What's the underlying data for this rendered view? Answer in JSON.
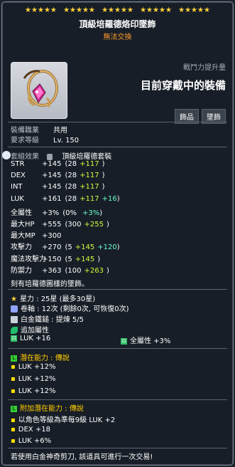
{
  "stars": [
    "★★★★★",
    "★★★★★",
    "★★★★★",
    "★★★★★",
    "★★★★★"
  ],
  "title": "頂級培羅德烙印墜飾",
  "subtitle": "無法交換",
  "combat_power": {
    "label": "戰鬥力提升量",
    "value": "目前穿戴中的裝備"
  },
  "tags": [
    "飾品",
    "墜飾"
  ],
  "requirements": [
    {
      "label": "裝備職業",
      "value": "共用"
    },
    {
      "label": "要求等級",
      "value": "Lv. 150"
    }
  ],
  "set": {
    "label": "套組效果",
    "value": "頂級培羅德套裝"
  },
  "stats": [
    {
      "name": "STR",
      "total": "+145",
      "base": "(28",
      "bonus": "+117",
      "extra": "",
      "close": ")"
    },
    {
      "name": "DEX",
      "total": "+145",
      "base": "(28",
      "bonus": "+117",
      "extra": "",
      "close": ")"
    },
    {
      "name": "INT",
      "total": "+145",
      "base": "(28",
      "bonus": "+117",
      "extra": "",
      "close": ")"
    },
    {
      "name": "LUK",
      "total": "+161",
      "base": "(28",
      "bonus": "+117",
      "extra": "+16",
      "close": ")"
    },
    {
      "name": "全屬性",
      "total": "+3%",
      "base": "(0%",
      "bonus": "",
      "extra": "+3%",
      "close": ")"
    },
    {
      "name": "最大HP",
      "total": "+555",
      "base": "(300",
      "bonus": "+255",
      "extra": "",
      "close": ")"
    },
    {
      "name": "最大MP",
      "total": "+300",
      "base": "",
      "bonus": "",
      "extra": "",
      "close": ""
    },
    {
      "name": "攻擊力",
      "total": "+270",
      "base": "(5",
      "bonus": "+145",
      "extra": "+120",
      "close": ")"
    },
    {
      "name": "魔法攻擊力",
      "total": "+150",
      "base": "(5",
      "bonus": "+145",
      "extra": "",
      "close": ")"
    },
    {
      "name": "防禦力",
      "total": "+363",
      "base": "(100",
      "bonus": "+263",
      "extra": "",
      "close": ")"
    }
  ],
  "description": "刻有培羅德圖樣的墜飾。",
  "enhance": [
    {
      "icon": "star-icon",
      "text": "星力 : 25星 (最多30星)"
    },
    {
      "icon": "scroll-icon",
      "text": "卷軸 : 12次 (剩餘0次, 可恢復0次)"
    },
    {
      "icon": "hammer-icon",
      "text": "白金鐵鎚 : 提煉 5/5"
    }
  ],
  "extra_attr": {
    "label": "追加屬性",
    "items": [
      {
        "text": "LUK  +16"
      },
      {
        "text": "全屬性  +3%"
      }
    ]
  },
  "potential": {
    "label": "潛在能力 : 傳說",
    "lines": [
      "LUK +12%",
      "LUK +12%",
      "LUK +12%"
    ]
  },
  "additional_potential": {
    "label": "附加潛在能力 : 傳說",
    "lines": [
      "以角色等級為準每9級 LUK +2",
      "DEX +18",
      "LUK +6%"
    ]
  },
  "footer": "若使用白金神奇剪刀, 該道具可進行一次交易!",
  "colors": {
    "stat_bonus": "#cdfd3b",
    "stat_extra": "#66ffcc",
    "stat_star": "#ffb000",
    "legendary": "#33cc33"
  }
}
